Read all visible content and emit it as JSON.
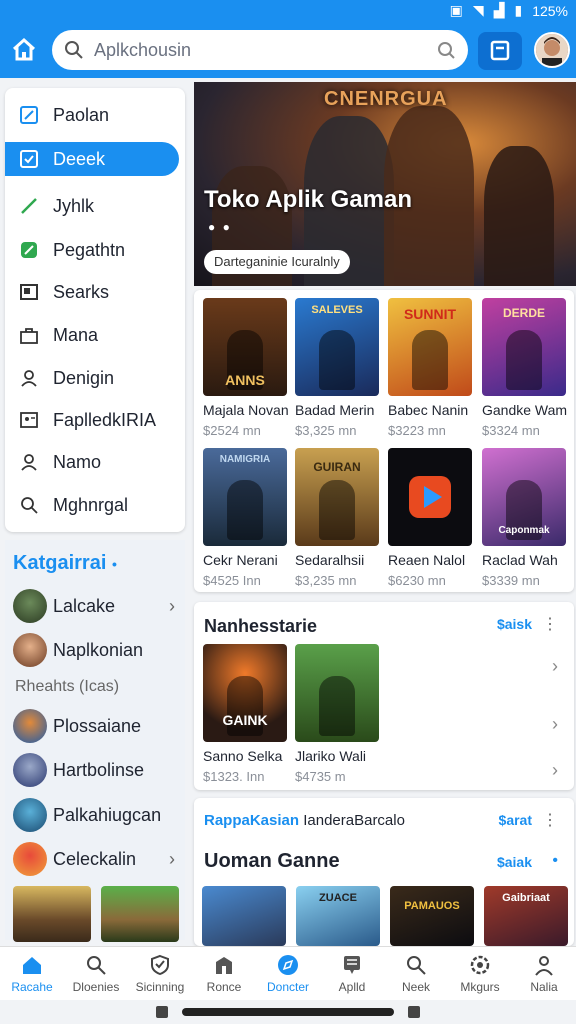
{
  "status": {
    "battery": "125%"
  },
  "search": {
    "placeholder": "Aplkchousin"
  },
  "menu": [
    {
      "label": "Paolan",
      "icon": "edit-icon"
    },
    {
      "label": "Deeek",
      "icon": "checkbox-icon",
      "active": true
    },
    {
      "label": "Jyhlk",
      "icon": "check-icon"
    },
    {
      "label": "Pegathtn",
      "icon": "leaf-icon"
    },
    {
      "label": "Searks",
      "icon": "card-icon"
    },
    {
      "label": "Mana",
      "icon": "bag-icon"
    },
    {
      "label": "Denigin",
      "icon": "user-icon"
    },
    {
      "label": "FaplledkIRIA",
      "icon": "id-card-icon"
    },
    {
      "label": "Namo",
      "icon": "person-icon"
    },
    {
      "label": "Mghnrgal",
      "icon": "search-icon"
    }
  ],
  "categories": {
    "title": "Katgairrai",
    "subtitle": "Rheahts (Icas)",
    "items": [
      {
        "label": "Lalcake"
      },
      {
        "label": "Naplkonian"
      },
      {
        "label": "Plossaiane"
      },
      {
        "label": "Hartbolinse"
      },
      {
        "label": "Palkahiugcan"
      },
      {
        "label": "Celeckalin"
      }
    ]
  },
  "banner": {
    "logo": "CNENRGUA",
    "title": "Toko Aplik Gaman",
    "pill": "Darteganinie Icuralnly"
  },
  "games": [
    {
      "name": "Majala Novan",
      "price": "$2524 mn",
      "art": "ANNS"
    },
    {
      "name": "Badad Merin",
      "price": "$3,325 mn",
      "art": "SALEVES"
    },
    {
      "name": "Babec Nanin",
      "price": "$3223 mn",
      "art": "SUNNIT"
    },
    {
      "name": "Gandke Wam",
      "price": "$3324 mn",
      "art": "DERDE"
    },
    {
      "name": "Cekr Nerani",
      "price": "$4525 Inn",
      "art": "NAMIGRIA"
    },
    {
      "name": "Sedaralhsii",
      "price": "$3,235 mn",
      "art": "GUIRAN"
    },
    {
      "name": "Reaen Nalol",
      "price": "$6230 mn",
      "art": ""
    },
    {
      "name": "Raclad Wah",
      "price": "$3339 mn",
      "art": "Caponmak"
    }
  ],
  "section": {
    "title": "Nanhesstarie",
    "link": "$aisk",
    "items": [
      {
        "name": "Sanno Selka",
        "price": "$1323. Inn",
        "art": "GAINK"
      },
      {
        "name": "Jlariko Wali",
        "price": "$4735 m",
        "art": ""
      }
    ]
  },
  "bottom_card": {
    "line_blue": "RappaKasian",
    "line_dark": "IanderaBarcalo",
    "line_link": "$arat",
    "title": "Uoman Ganne",
    "title_link": "$aiak",
    "thumb_labels": [
      "",
      "ZUACE",
      "PAMAUOS",
      "Gaibriaat"
    ]
  },
  "bottomnav": [
    {
      "label": "Racahe",
      "icon": "home-icon",
      "active": true
    },
    {
      "label": "Dloenies",
      "icon": "search-icon"
    },
    {
      "label": "Sicinning",
      "icon": "shield-icon"
    },
    {
      "label": "Ronce",
      "icon": "building-icon"
    },
    {
      "label": "Doncter",
      "icon": "compass-icon",
      "active": true
    },
    {
      "label": "Aplld",
      "icon": "doc-icon"
    },
    {
      "label": "Neek",
      "icon": "search-icon"
    },
    {
      "label": "Mkgurs",
      "icon": "settings-icon"
    },
    {
      "label": "Nalia",
      "icon": "profile-icon"
    }
  ]
}
